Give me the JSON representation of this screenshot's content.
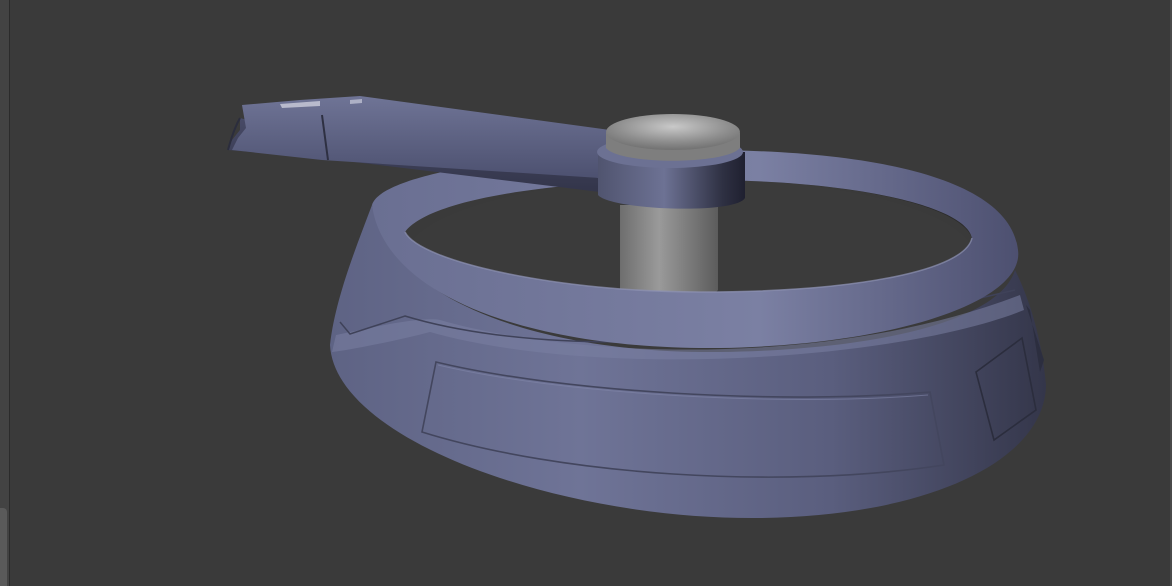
{
  "viewport": {
    "background": "#3a3a3a",
    "object": "3d-model-turntable",
    "material_color": "#6e7396",
    "accent_color": "#8a8a8a"
  },
  "icons": {
    "corner_widget": "viewport-corner-tab"
  }
}
